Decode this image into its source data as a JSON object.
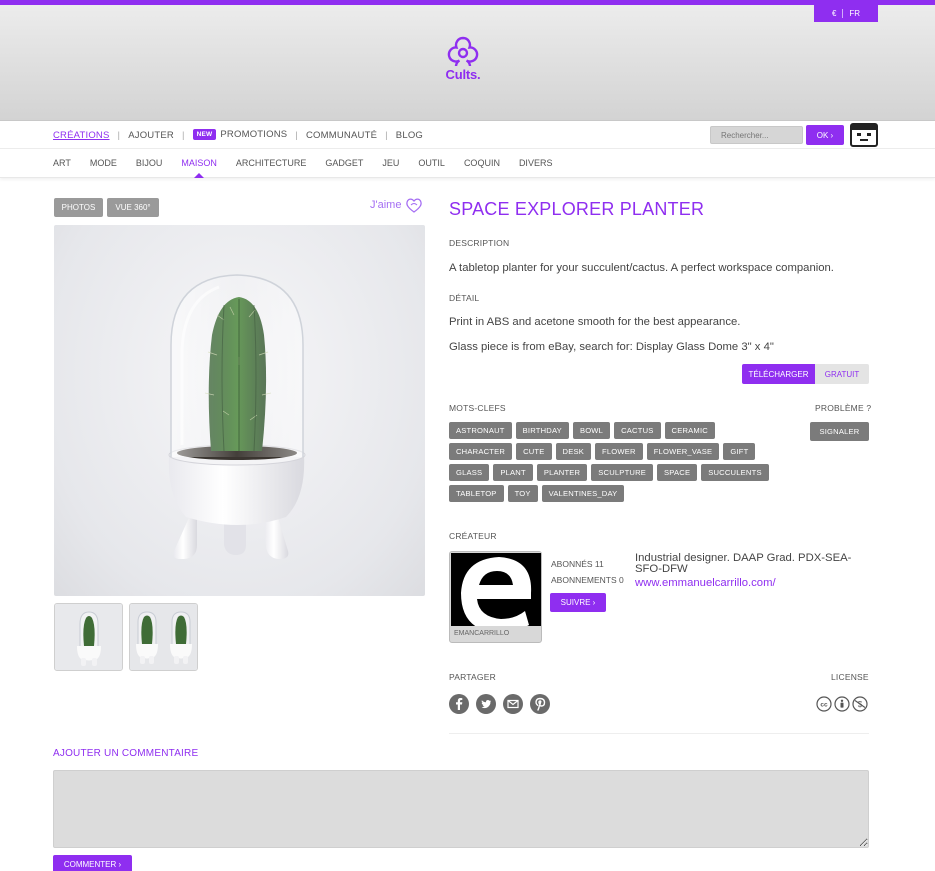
{
  "header": {
    "currency": [
      "€",
      "FR"
    ],
    "logo_text": "Cults."
  },
  "nav": {
    "items": [
      {
        "label": "CRÉATIONS",
        "active": true
      },
      {
        "label": "AJOUTER"
      },
      {
        "label": "PROMOTIONS",
        "badge": "NEW"
      },
      {
        "label": "COMMUNAUTÉ"
      },
      {
        "label": "BLOG"
      }
    ],
    "search_placeholder": "Rechercher...",
    "search_button": "OK ›"
  },
  "categories": {
    "items": [
      "ART",
      "MODE",
      "BIJOU",
      "MAISON",
      "ARCHITECTURE",
      "GADGET",
      "JEU",
      "OUTIL",
      "COQUIN",
      "DIVERS"
    ],
    "active": "MAISON"
  },
  "gallery": {
    "photos_button": "PHOTOS",
    "view360_button": "VUE 360°",
    "like_label": "J'aime"
  },
  "product": {
    "title": "SPACE EXPLORER PLANTER",
    "description_label": "DESCRIPTION",
    "description": "A tabletop planter for your succulent/cactus. A perfect workspace companion.",
    "detail_label": "DÉTAIL",
    "detail_1": "Print in ABS and acetone smooth for the best appearance.",
    "detail_2": "Glass piece is from eBay, search for: Display Glass Dome 3\" x 4\"",
    "download_button": "TÉLÉCHARGER",
    "price_badge": "GRATUIT"
  },
  "keywords": {
    "label": "MOTS-CLEFS",
    "tags": [
      "ASTRONAUT",
      "BIRTHDAY",
      "BOWL",
      "CACTUS",
      "CERAMIC",
      "CHARACTER",
      "CUTE",
      "DESK",
      "FLOWER",
      "FLOWER_VASE",
      "GIFT",
      "GLASS",
      "PLANT",
      "PLANTER",
      "SCULPTURE",
      "SPACE",
      "SUCCULENTS",
      "TABLETOP",
      "TOY",
      "VALENTINES_DAY"
    ],
    "problem_label": "PROBLÈME ?",
    "report_button": "SIGNALER"
  },
  "creator": {
    "label": "CRÉATEUR",
    "name": "EMANCARRILLO",
    "followers": "ABONNÉS 11",
    "following": "ABONNEMENTS 0",
    "follow_button": "SUIVRE ›",
    "bio": "Industrial designer. DAAP Grad. PDX-SEA-SFO-DFW",
    "website": "www.emmanuelcarrillo.com/"
  },
  "share": {
    "label": "PARTAGER",
    "icons": [
      "facebook-icon",
      "twitter-icon",
      "email-icon",
      "pinterest-icon"
    ],
    "license_label": "LICENSE",
    "license_icons": [
      "cc-icon",
      "attribution-icon",
      "noncommercial-icon"
    ]
  },
  "comment": {
    "label": "AJOUTER UN COMMENTAIRE",
    "value": "",
    "submit_button": "COMMENTER ›"
  },
  "colors": {
    "accent": "#8f2ef0",
    "tag_gray": "#7b7b7b"
  }
}
